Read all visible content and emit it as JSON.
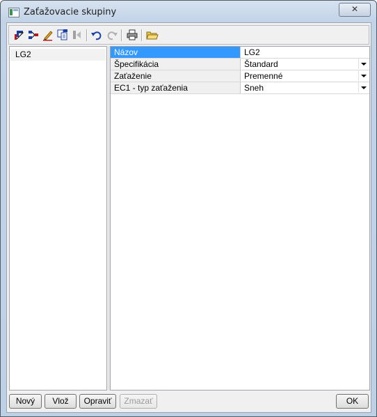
{
  "window": {
    "title": "Zaťažovacie skupiny",
    "close_label": "✕"
  },
  "toolbar": {
    "icons": [
      "properties-icon",
      "group-icon",
      "edit-icon",
      "copy-icon",
      "delete-icon",
      "undo-icon",
      "redo-icon",
      "print-icon",
      "open-folder-icon"
    ]
  },
  "list": {
    "items": [
      {
        "label": "LG2",
        "selected": true
      }
    ]
  },
  "properties": {
    "rows": [
      {
        "name": "Názov",
        "value": "LG2",
        "has_dropdown": false,
        "selected": true
      },
      {
        "name": "Špecifikácia",
        "value": "Štandard",
        "has_dropdown": true,
        "selected": false
      },
      {
        "name": "Zaťaženie",
        "value": "Premenné",
        "has_dropdown": true,
        "selected": false
      },
      {
        "name": "EC1 - typ zaťaženia",
        "value": "Sneh",
        "has_dropdown": true,
        "selected": false
      }
    ]
  },
  "buttons": {
    "new": "Nový",
    "insert": "Vlož",
    "edit": "Opraviť",
    "delete": "Zmazať",
    "ok": "OK"
  },
  "colors": {
    "selection": "#3399ff",
    "frame": "#c2d3e8"
  }
}
